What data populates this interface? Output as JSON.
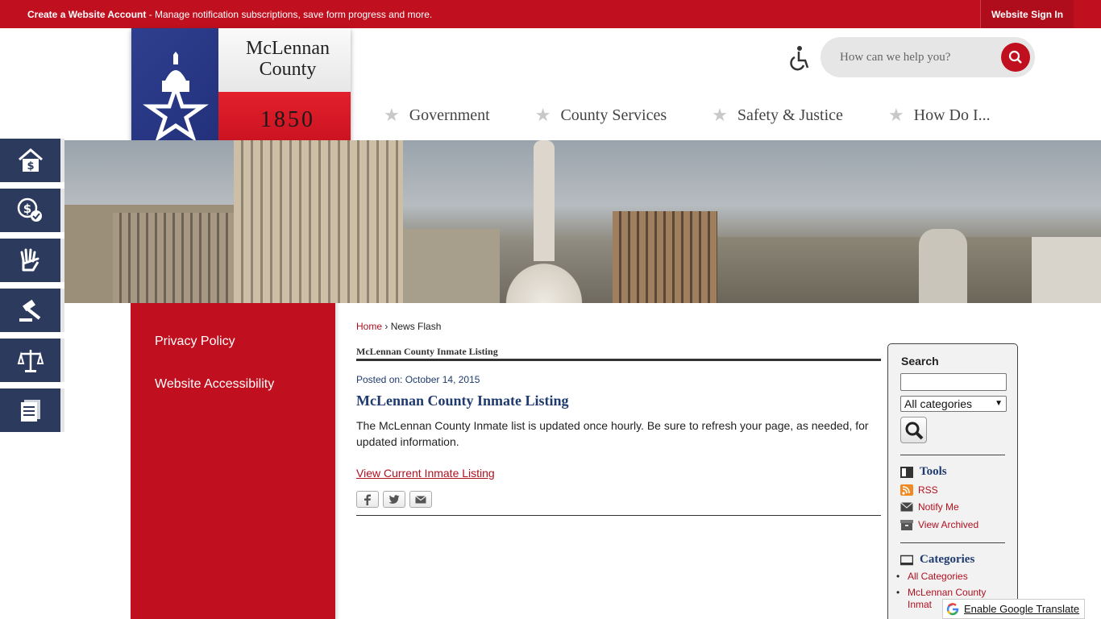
{
  "topbar": {
    "account_link": "Create a Website Account",
    "account_desc": " - Manage notification subscriptions, save form progress and more.",
    "sign_in": "Website Sign In"
  },
  "logo": {
    "line1": "McLennan",
    "line2": "County",
    "year": "1850"
  },
  "search": {
    "placeholder": "How can we help you?"
  },
  "nav": [
    "Government",
    "County Services",
    "Safety & Justice",
    "How Do I..."
  ],
  "quick_links": [
    "home-tax-icon",
    "payment-check-icon",
    "volunteer-hand-icon",
    "gavel-icon",
    "scales-icon",
    "documents-icon"
  ],
  "sidebar": {
    "items": [
      "Privacy Policy",
      "Website Accessibility"
    ]
  },
  "breadcrumb": {
    "home": "Home",
    "separator": "›",
    "current": "News Flash"
  },
  "module_title": "McLennan County Inmate Listing",
  "article": {
    "posted": "Posted on: October 14, 2015",
    "headline": "McLennan County Inmate Listing",
    "body": "The McLennan County Inmate list is updated once hourly. Be sure to refresh your page, as needed, for updated information.",
    "link": "View Current Inmate Listing"
  },
  "right": {
    "search_title": "Search",
    "category_select": "All categories",
    "tools_title": "Tools",
    "tools": [
      "RSS",
      "Notify Me",
      "View Archived"
    ],
    "categories_title": "Categories",
    "categories": [
      "All Categories",
      "McLennan County Inmat"
    ]
  },
  "translate": "Enable Google Translate",
  "colors": {
    "brand_red": "#c0101f",
    "navy": "#1e3a6e",
    "quick_bg": "#2c3a5e"
  }
}
